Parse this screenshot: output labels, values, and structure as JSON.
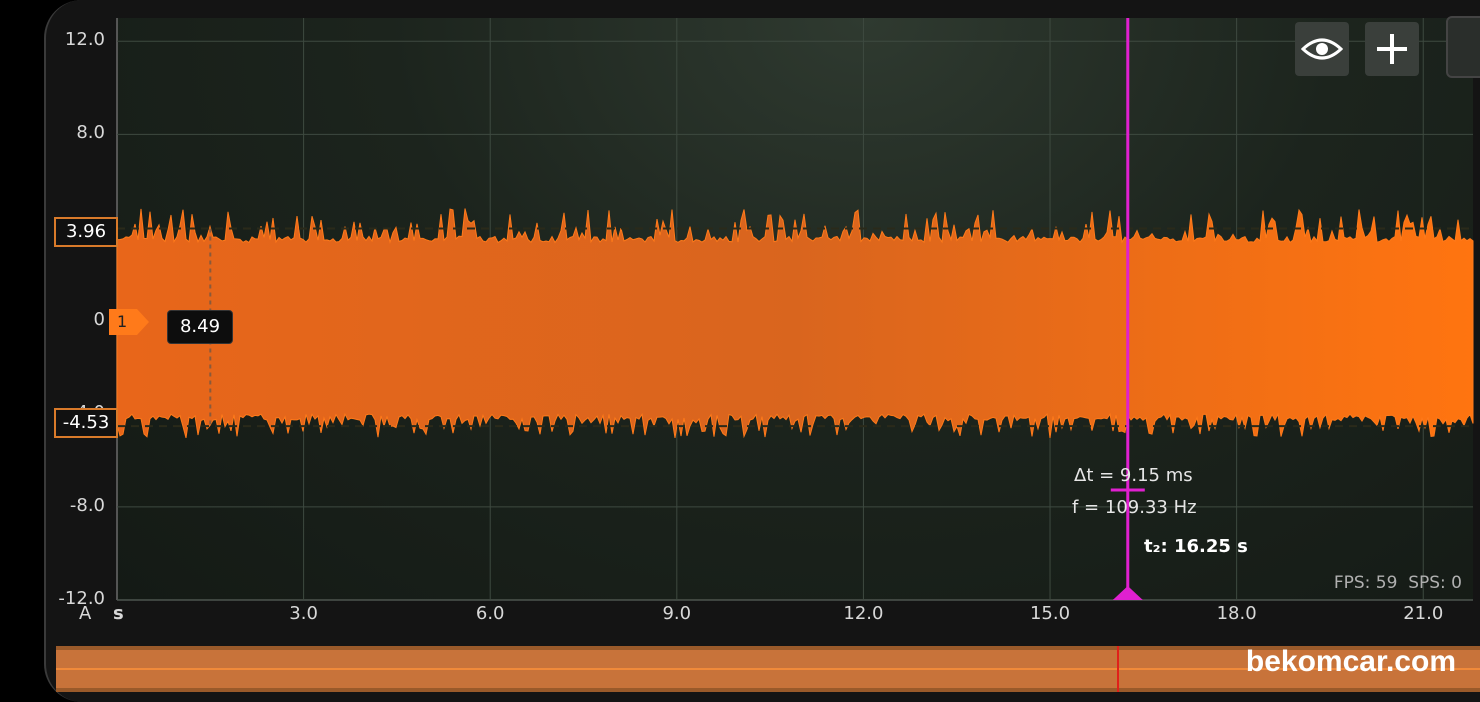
{
  "chart_data": {
    "type": "line",
    "x_unit": "s",
    "y_unit": "A",
    "xlim": [
      0,
      21.8
    ],
    "ylim": [
      -12.0,
      13.0
    ],
    "y_ticks": [
      "12.0",
      "8.0",
      "0",
      "-4.0",
      "-8.0",
      "-12.0"
    ],
    "y_tick_values": [
      12,
      8,
      0,
      -4,
      -8,
      -12
    ],
    "x_ticks": [
      "3.0",
      "6.0",
      "9.0",
      "12.0",
      "15.0",
      "18.0",
      "21.0"
    ],
    "x_tick_values": [
      3,
      6,
      9,
      12,
      15,
      18,
      21
    ],
    "grid": true,
    "signal": {
      "channel": "1",
      "upper_envelope": 3.96,
      "lower_envelope": -4.53,
      "color": "#ff7a1a"
    },
    "reference_levels": [
      {
        "label": "3.96",
        "value": 3.96
      },
      {
        "label": "-4.53",
        "value": -4.53
      }
    ],
    "cursor": {
      "label": "t₂: 16.25 s",
      "value": 16.25,
      "color": "#e020d0"
    },
    "marker_value": {
      "label": "8.49",
      "x": 1.5
    }
  },
  "channel_label": "1",
  "measurements": {
    "delta_t": "Δt = 9.15 ms",
    "frequency": "f = 109.33 Hz"
  },
  "status": {
    "fps": "FPS: 59",
    "sps": "SPS: 0"
  },
  "toolbar": {
    "eye_icon": "eye-icon",
    "add_icon": "plus-icon"
  },
  "watermark": "bekomcar.com",
  "colors": {
    "accent": "#ff7a1a",
    "cursor": "#e020d0",
    "background": "#1c241d"
  }
}
